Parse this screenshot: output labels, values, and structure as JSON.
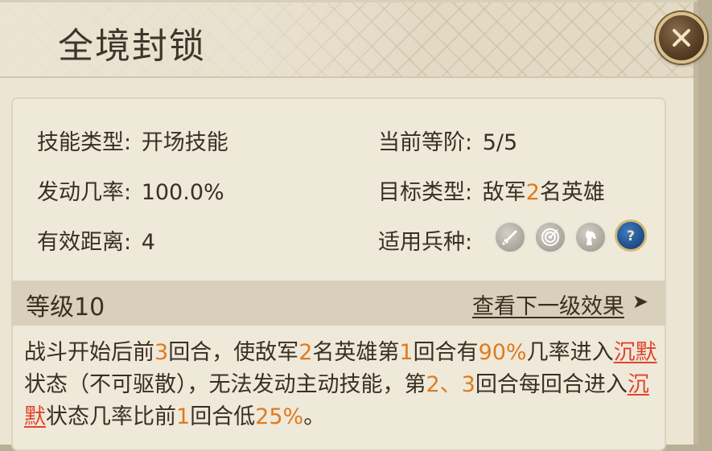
{
  "title": "全境封锁",
  "close_label": "X",
  "stats": {
    "skill_type_label": "技能类型:",
    "skill_type_value": "开场技能",
    "current_rank_label": "当前等阶:",
    "current_rank_value": "5/5",
    "trigger_rate_label": "发动几率:",
    "trigger_rate_value": "100.0%",
    "target_type_label": "目标类型:",
    "target_type_pre": "敌军",
    "target_type_num": "2",
    "target_type_post": "名英雄",
    "range_label": "有效距离:",
    "range_value": "4",
    "troops_label": "适用兵种:"
  },
  "troop_icons": [
    "sword-icon",
    "archery-target-icon",
    "horse-icon",
    "question-icon"
  ],
  "level": {
    "label": "等级10",
    "next_link": "查看下一级效果",
    "arrow": "➤"
  },
  "description": {
    "p1": "战斗开始后前",
    "n1": "3",
    "p2": "回合，使敌军",
    "n2": "2",
    "p3": "名英雄第",
    "n3": "1",
    "p4": "回合有",
    "n4": "90%",
    "p5": "几率进入",
    "k1": "沉默",
    "p6": "状态（不可驱散），无法发动主动技能，第",
    "n5": "2、3",
    "p7": "回合每回合进入",
    "k2": "沉默",
    "p8": "状态几率比前",
    "n6": "1",
    "p9": "回合低",
    "n7": "25%",
    "p10": "。"
  },
  "colors": {
    "highlight_number": "#e07a1c",
    "highlight_keyword": "#e0442c",
    "panel_bg": "#ece5d4"
  }
}
